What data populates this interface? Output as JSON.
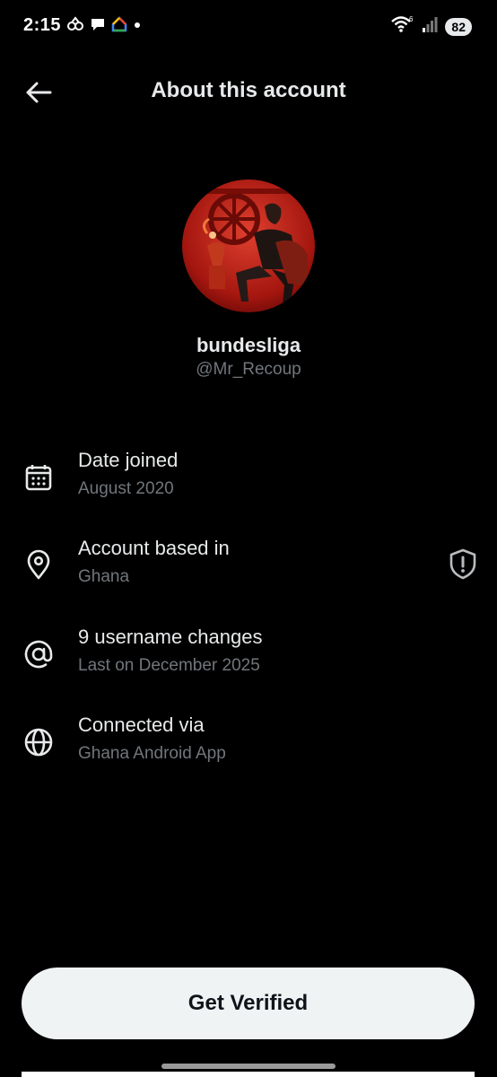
{
  "status_bar": {
    "time": "2:15",
    "left_icons": [
      "link-icon",
      "chat-icon",
      "home-color-icon",
      "dot-icon"
    ],
    "wifi_label": "6",
    "battery": "82"
  },
  "header": {
    "title": "About this account",
    "back_icon": "arrow-left-icon"
  },
  "profile": {
    "display_name": "bundesliga",
    "handle": "@Mr_Recoup"
  },
  "info": [
    {
      "title": "Date joined",
      "subtitle": "August 2020",
      "icon": "calendar-icon"
    },
    {
      "title": "Account based in",
      "subtitle": "Ghana",
      "icon": "location-pin-icon",
      "trailing_icon": "shield-alert-icon"
    },
    {
      "title": "9 username changes",
      "subtitle": "Last on December 2025",
      "icon": "at-sign-icon"
    },
    {
      "title": "Connected via",
      "subtitle": "Ghana Android App",
      "icon": "globe-icon"
    }
  ],
  "actions": {
    "verify_label": "Get Verified"
  },
  "colors": {
    "background": "#000000",
    "text_primary": "#e7e9ea",
    "text_secondary": "#71767b",
    "button_bg": "#eff3f4",
    "avatar_red": "#c0261d"
  }
}
